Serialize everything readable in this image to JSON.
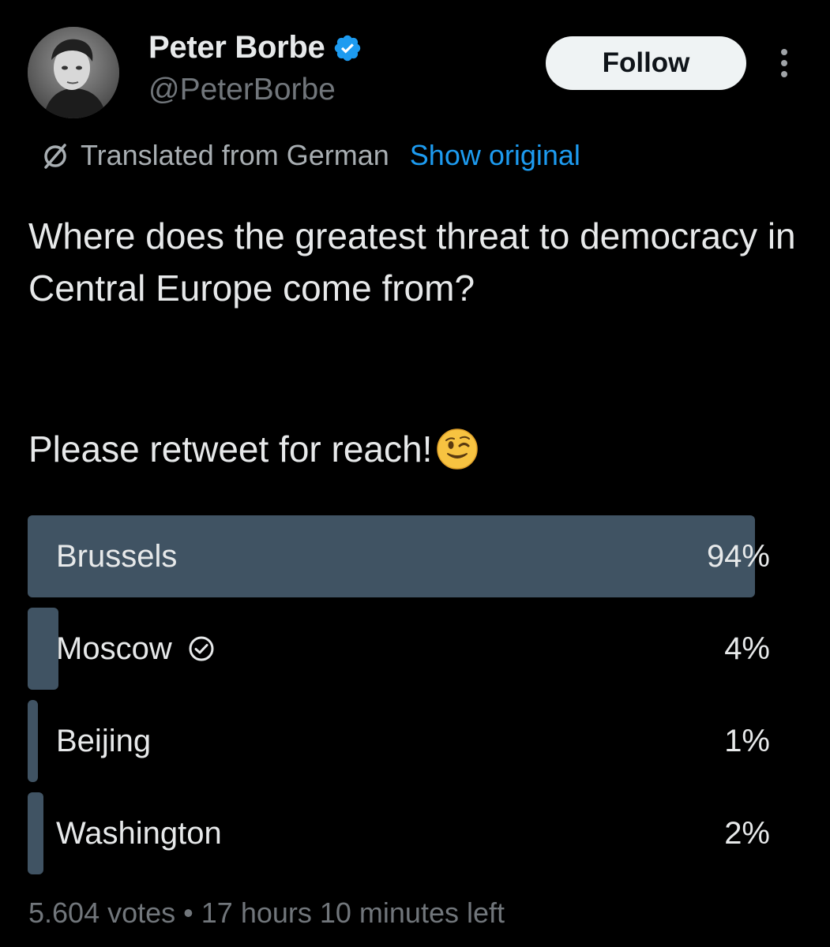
{
  "author": {
    "display_name": "Peter Borbe",
    "handle": "@PeterBorbe",
    "verified": true
  },
  "actions": {
    "follow_label": "Follow",
    "more_icon": "more-vertical-icon"
  },
  "translation": {
    "label": "Translated from German",
    "show_original": "Show original"
  },
  "tweet": {
    "question": "Where does the greatest threat to democracy in Central Europe come from?",
    "call_to_action": "Please retweet for reach!",
    "emoji": "winking-face"
  },
  "poll": {
    "options": [
      {
        "label": "Brussels",
        "percent_text": "94%",
        "percent": 94,
        "leading": true,
        "user_choice": false
      },
      {
        "label": "Moscow",
        "percent_text": "4%",
        "percent": 4,
        "leading": false,
        "user_choice": true
      },
      {
        "label": "Beijing",
        "percent_text": "1%",
        "percent": 1,
        "leading": false,
        "user_choice": false
      },
      {
        "label": "Washington",
        "percent_text": "2%",
        "percent": 2,
        "leading": false,
        "user_choice": false
      }
    ],
    "votes": "5.604 votes",
    "separator": "•",
    "time_left": "17 hours 10 minutes left"
  },
  "colors": {
    "background": "#000000",
    "text": "#e7e9ea",
    "secondary": "#71767b",
    "link": "#1d9bf0",
    "poll_bar": "#405363",
    "verified": "#1d9bf0"
  }
}
